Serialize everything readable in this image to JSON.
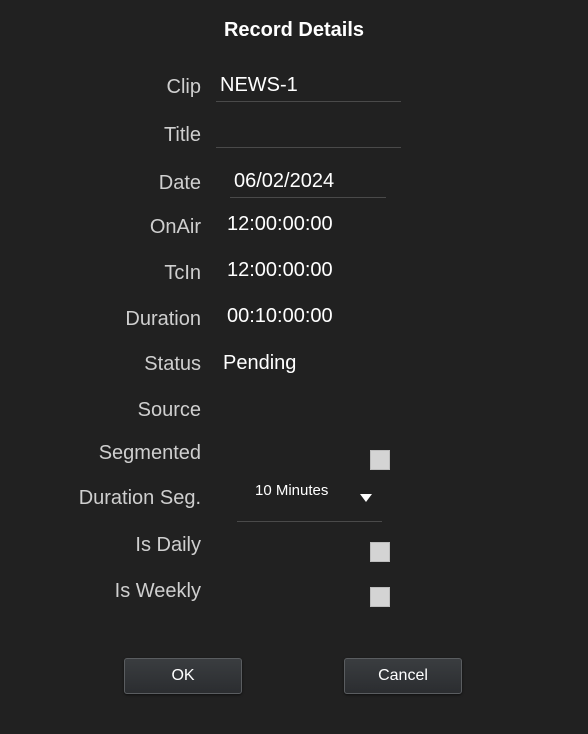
{
  "dialog": {
    "title": "Record Details"
  },
  "fields": {
    "clip": {
      "label": "Clip",
      "value": "NEWS-1"
    },
    "title": {
      "label": "Title",
      "value": ""
    },
    "date": {
      "label": "Date",
      "value": "06/02/2024"
    },
    "onair": {
      "label": "OnAir",
      "value": "12:00:00:00"
    },
    "tcin": {
      "label": "TcIn",
      "value": "12:00:00:00"
    },
    "duration": {
      "label": "Duration",
      "value": "00:10:00:00"
    },
    "status": {
      "label": "Status",
      "value": "Pending"
    },
    "source": {
      "label": "Source",
      "value": ""
    },
    "segmented": {
      "label": "Segmented",
      "checked": false
    },
    "duration_seg": {
      "label": "Duration Seg.",
      "value": "10 Minutes"
    },
    "is_daily": {
      "label": "Is Daily",
      "checked": false
    },
    "is_weekly": {
      "label": "Is Weekly",
      "checked": false
    }
  },
  "buttons": {
    "ok": "OK",
    "cancel": "Cancel"
  },
  "icons": {
    "dropdown": "chevron-down-icon"
  }
}
